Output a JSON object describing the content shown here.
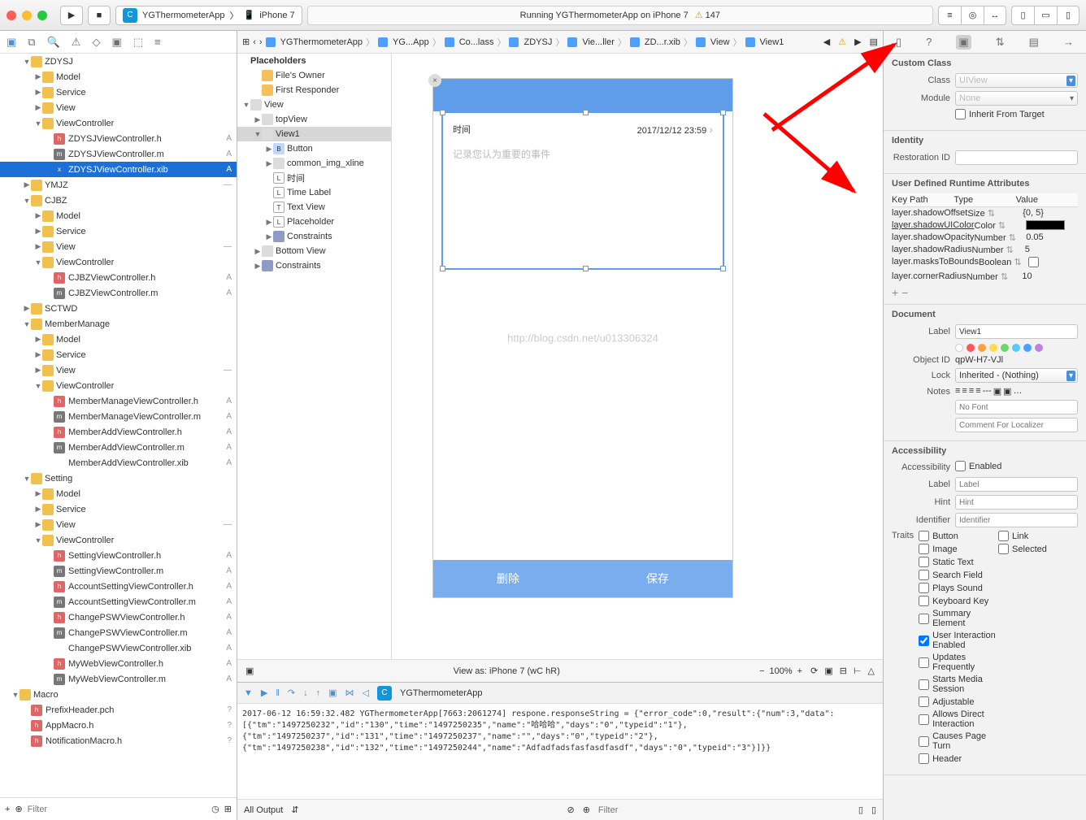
{
  "toolbar": {
    "scheme_app": "YGThermometerApp",
    "scheme_device": "iPhone 7",
    "status": "Running YGThermometerApp on iPhone 7",
    "warn": "147"
  },
  "nav": {
    "filter_ph": "Filter"
  },
  "tree": [
    {
      "d": 1,
      "t": "folder",
      "c": "y",
      "l": "ZDYSJ",
      "exp": 1
    },
    {
      "d": 2,
      "t": "folder",
      "c": "y",
      "l": "Model",
      "cls": 1
    },
    {
      "d": 2,
      "t": "folder",
      "c": "y",
      "l": "Service",
      "cls": 1
    },
    {
      "d": 2,
      "t": "folder",
      "c": "y",
      "l": "View",
      "cls": 1
    },
    {
      "d": 2,
      "t": "folder",
      "c": "y",
      "l": "ViewController",
      "exp": 1
    },
    {
      "d": 3,
      "t": "file",
      "ic": "h",
      "l": "ZDYSJViewController.h",
      "s": "A"
    },
    {
      "d": 3,
      "t": "file",
      "ic": "m",
      "l": "ZDYSJViewController.m",
      "s": "A"
    },
    {
      "d": 3,
      "t": "file",
      "ic": "x",
      "l": "ZDYSJViewController.xib",
      "s": "A",
      "sel": 1
    },
    {
      "d": 1,
      "t": "folder",
      "c": "y",
      "l": "YMJZ",
      "cls": 1,
      "s": "—"
    },
    {
      "d": 1,
      "t": "folder",
      "c": "y",
      "l": "CJBZ",
      "exp": 1
    },
    {
      "d": 2,
      "t": "folder",
      "c": "y",
      "l": "Model",
      "cls": 1
    },
    {
      "d": 2,
      "t": "folder",
      "c": "y",
      "l": "Service",
      "cls": 1
    },
    {
      "d": 2,
      "t": "folder",
      "c": "y",
      "l": "View",
      "cls": 1,
      "s": "—"
    },
    {
      "d": 2,
      "t": "folder",
      "c": "y",
      "l": "ViewController",
      "exp": 1
    },
    {
      "d": 3,
      "t": "file",
      "ic": "h",
      "l": "CJBZViewController.h",
      "s": "A"
    },
    {
      "d": 3,
      "t": "file",
      "ic": "m",
      "l": "CJBZViewController.m",
      "s": "A"
    },
    {
      "d": 1,
      "t": "folder",
      "c": "y",
      "l": "SCTWD",
      "cls": 1
    },
    {
      "d": 1,
      "t": "folder",
      "c": "y",
      "l": "MemberManage",
      "exp": 1
    },
    {
      "d": 2,
      "t": "folder",
      "c": "y",
      "l": "Model",
      "cls": 1
    },
    {
      "d": 2,
      "t": "folder",
      "c": "y",
      "l": "Service",
      "cls": 1
    },
    {
      "d": 2,
      "t": "folder",
      "c": "y",
      "l": "View",
      "cls": 1,
      "s": "—"
    },
    {
      "d": 2,
      "t": "folder",
      "c": "y",
      "l": "ViewController",
      "exp": 1
    },
    {
      "d": 3,
      "t": "file",
      "ic": "h",
      "l": "MemberManageViewController.h",
      "s": "A"
    },
    {
      "d": 3,
      "t": "file",
      "ic": "m",
      "l": "MemberManageViewController.m",
      "s": "A"
    },
    {
      "d": 3,
      "t": "file",
      "ic": "h",
      "l": "MemberAddViewController.h",
      "s": "A"
    },
    {
      "d": 3,
      "t": "file",
      "ic": "m",
      "l": "MemberAddViewController.m",
      "s": "A"
    },
    {
      "d": 3,
      "t": "file",
      "ic": "x",
      "l": "MemberAddViewController.xib",
      "s": "A"
    },
    {
      "d": 1,
      "t": "folder",
      "c": "y",
      "l": "Setting",
      "exp": 1
    },
    {
      "d": 2,
      "t": "folder",
      "c": "y",
      "l": "Model",
      "cls": 1
    },
    {
      "d": 2,
      "t": "folder",
      "c": "y",
      "l": "Service",
      "cls": 1
    },
    {
      "d": 2,
      "t": "folder",
      "c": "y",
      "l": "View",
      "cls": 1,
      "s": "—"
    },
    {
      "d": 2,
      "t": "folder",
      "c": "y",
      "l": "ViewController",
      "exp": 1
    },
    {
      "d": 3,
      "t": "file",
      "ic": "h",
      "l": "SettingViewController.h",
      "s": "A"
    },
    {
      "d": 3,
      "t": "file",
      "ic": "m",
      "l": "SettingViewController.m",
      "s": "A"
    },
    {
      "d": 3,
      "t": "file",
      "ic": "h",
      "l": "AccountSettingViewController.h",
      "s": "A"
    },
    {
      "d": 3,
      "t": "file",
      "ic": "m",
      "l": "AccountSettingViewController.m",
      "s": "A"
    },
    {
      "d": 3,
      "t": "file",
      "ic": "h",
      "l": "ChangePSWViewController.h",
      "s": "A"
    },
    {
      "d": 3,
      "t": "file",
      "ic": "m",
      "l": "ChangePSWViewController.m",
      "s": "A"
    },
    {
      "d": 3,
      "t": "file",
      "ic": "x",
      "l": "ChangePSWViewController.xib",
      "s": "A"
    },
    {
      "d": 3,
      "t": "file",
      "ic": "h",
      "l": "MyWebViewController.h",
      "s": "A"
    },
    {
      "d": 3,
      "t": "file",
      "ic": "m",
      "l": "MyWebViewController.m",
      "s": "A"
    },
    {
      "d": 0,
      "t": "folder",
      "c": "y",
      "l": "Macro",
      "exp": 1
    },
    {
      "d": 1,
      "t": "file",
      "ic": "h",
      "l": "PrefixHeader.pch",
      "s": "?"
    },
    {
      "d": 1,
      "t": "file",
      "ic": "h",
      "l": "AppMacro.h",
      "s": "?"
    },
    {
      "d": 1,
      "t": "file",
      "ic": "h",
      "l": "NotificationMacro.h",
      "s": "?"
    }
  ],
  "jump": [
    "YGThermometerApp",
    "YG...App",
    "Co...lass",
    "ZDYSJ",
    "Vie...ller",
    "ZD...r.xib",
    "View",
    "View1"
  ],
  "outline": [
    {
      "d": 0,
      "ic": "hdr",
      "l": "Placeholders"
    },
    {
      "d": 1,
      "ic": "ph",
      "l": "File's Owner"
    },
    {
      "d": 1,
      "ic": "ph",
      "l": "First Responder"
    },
    {
      "d": 0,
      "ic": "v",
      "l": "View",
      "exp": 1,
      "dis": 1
    },
    {
      "d": 1,
      "ic": "v",
      "l": "topView",
      "dis": 1,
      "cls": 1
    },
    {
      "d": 1,
      "ic": "v",
      "l": "View1",
      "exp": 1,
      "sel": 1,
      "dis": 1
    },
    {
      "d": 2,
      "ic": "b",
      "l": "Button",
      "dis": 1,
      "cls": 1
    },
    {
      "d": 2,
      "ic": "v",
      "l": "common_img_xline",
      "dis": 1,
      "cls": 1
    },
    {
      "d": 2,
      "ic": "l",
      "l": "时间"
    },
    {
      "d": 2,
      "ic": "l",
      "l": "Time Label"
    },
    {
      "d": 2,
      "ic": "t",
      "l": "Text View"
    },
    {
      "d": 2,
      "ic": "l",
      "l": "Placeholder",
      "dis": 1,
      "cls": 1
    },
    {
      "d": 2,
      "ic": "c",
      "l": "Constraints",
      "dis": 1,
      "cls": 1
    },
    {
      "d": 1,
      "ic": "v",
      "l": "Bottom View",
      "dis": 1,
      "cls": 1
    },
    {
      "d": 1,
      "ic": "c",
      "l": "Constraints",
      "dis": 1,
      "cls": 1
    }
  ],
  "canvas": {
    "time_label": "时间",
    "time_value": "2017/12/12 23:59",
    "placeholder": "记录您认为重要的事件",
    "delete": "删除",
    "save": "保存",
    "watermark": "http://blog.csdn.net/u013306324",
    "viewas": "View as: iPhone 7 (wC hR)",
    "zoom": "100%"
  },
  "debug": {
    "app": "YGThermometerApp",
    "console": "2017-06-12 16:59:32.482 YGThermometerApp[7663:2061274] respone.responseString = {\"error_code\":0,\"result\":{\"num\":3,\"data\":[{\"tm\":\"1497250232\",\"id\":\"130\",\"time\":\"1497250235\",\"name\":\"哈哈哈\",\"days\":\"0\",\"typeid\":\"1\"},{\"tm\":\"1497250237\",\"id\":\"131\",\"time\":\"1497250237\",\"name\":\"\",\"days\":\"0\",\"typeid\":\"2\"},{\"tm\":\"1497250238\",\"id\":\"132\",\"time\":\"1497250244\",\"name\":\"Adfadfadsfasfasdfasdf\",\"days\":\"0\",\"typeid\":\"3\"}]}}",
    "output": "All Output",
    "filter_ph": "Filter"
  },
  "inspector": {
    "custom": {
      "title": "Custom Class",
      "class_ph": "UIView",
      "module_ph": "None",
      "inherit": "Inherit From Target"
    },
    "identity": {
      "title": "Identity",
      "restoration": "Restoration ID"
    },
    "runtime": {
      "title": "User Defined Runtime Attributes",
      "cols": [
        "Key Path",
        "Type",
        "Value"
      ],
      "rows": [
        {
          "k": "layer.shadowOffset",
          "t": "Size",
          "v": "{0, 5}"
        },
        {
          "k": "layer.shadowUIColor",
          "t": "Color",
          "v": ""
        },
        {
          "k": "layer.shadowOpacity",
          "t": "Number",
          "v": "0.05"
        },
        {
          "k": "layer.shadowRadius",
          "t": "Number",
          "v": "5"
        },
        {
          "k": "layer.masksToBounds",
          "t": "Boolean",
          "v": ""
        },
        {
          "k": "layer.cornerRadius",
          "t": "Number",
          "v": "10"
        }
      ]
    },
    "doc": {
      "title": "Document",
      "label": "Label",
      "label_v": "View1",
      "objectid_l": "Object ID",
      "objectid": "qpW-H7-VJl",
      "lock_l": "Lock",
      "lock": "Inherited - (Nothing)",
      "notes_l": "Notes",
      "nofont": "No Font",
      "comment_ph": "Comment For Localizer"
    },
    "acc": {
      "title": "Accessibility",
      "enabled": "Enabled",
      "label_l": "Label",
      "label_ph": "Label",
      "hint_l": "Hint",
      "hint_ph": "Hint",
      "id_l": "Identifier",
      "id_ph": "Identifier",
      "traits_l": "Traits",
      "traits": [
        "Button",
        "Link",
        "Image",
        "Selected",
        "Static Text",
        "",
        "Search Field",
        "",
        "Plays Sound",
        "",
        "Keyboard Key",
        "",
        "Summary Element",
        "",
        "User Interaction Enabled",
        "",
        "Updates Frequently",
        "",
        "Starts Media Session",
        "",
        "Adjustable",
        "",
        "Allows Direct Interaction",
        "",
        "Causes Page Turn",
        "",
        "Header",
        ""
      ]
    }
  }
}
